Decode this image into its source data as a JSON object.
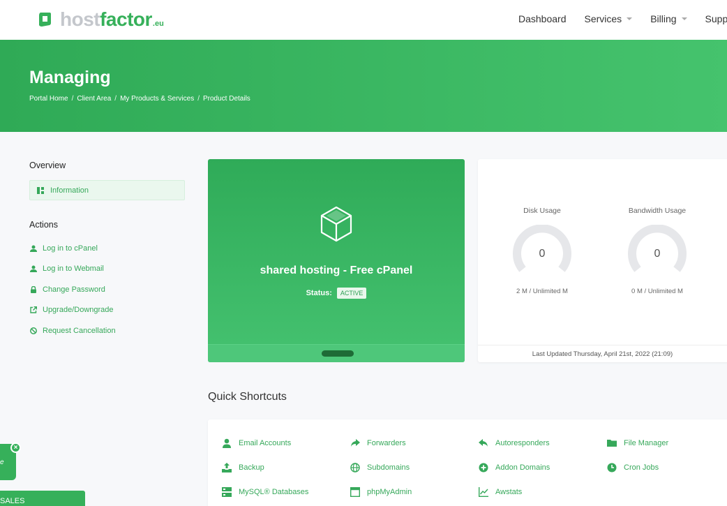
{
  "brand": {
    "host": "host",
    "factor": "factor",
    "tld": ".eu",
    "accent": "#36b05a"
  },
  "nav": [
    {
      "label": "Dashboard",
      "dropdown": false
    },
    {
      "label": "Services",
      "dropdown": true
    },
    {
      "label": "Billing",
      "dropdown": true
    },
    {
      "label": "Support",
      "dropdown": false
    }
  ],
  "banner": {
    "title": "Managing",
    "breadcrumb": [
      "Portal Home",
      "Client Area",
      "My Products & Services",
      "Product Details"
    ]
  },
  "sidebar": {
    "overview_title": "Overview",
    "overview_item": "Information",
    "actions_title": "Actions",
    "actions": [
      {
        "label": "Log in to cPanel",
        "icon": "user-icon"
      },
      {
        "label": "Log in to Webmail",
        "icon": "user-icon"
      },
      {
        "label": "Change Password",
        "icon": "lock-icon"
      },
      {
        "label": "Upgrade/Downgrade",
        "icon": "external-link-icon"
      },
      {
        "label": "Request Cancellation",
        "icon": "ban-icon"
      }
    ]
  },
  "product": {
    "name": "shared hosting - Free cPanel",
    "status_label": "Status:",
    "status_value": "ACTIVE"
  },
  "usage": {
    "disk": {
      "title": "Disk Usage",
      "value": "0",
      "detail": "2 M / Unlimited M",
      "fraction": 0
    },
    "bandwidth": {
      "title": "Bandwidth Usage",
      "value": "0",
      "detail": "0 M / Unlimited M",
      "fraction": 0
    },
    "last_updated": "Last Updated Thursday, April 21st, 2022 (21:09)"
  },
  "shortcuts": {
    "title": "Quick Shortcuts",
    "items": [
      {
        "label": "Email Accounts",
        "icon": "user-icon"
      },
      {
        "label": "Forwarders",
        "icon": "share-icon"
      },
      {
        "label": "Autoresponders",
        "icon": "reply-icon"
      },
      {
        "label": "File Manager",
        "icon": "folder-icon"
      },
      {
        "label": "Backup",
        "icon": "upload-icon"
      },
      {
        "label": "Subdomains",
        "icon": "globe-icon"
      },
      {
        "label": "Addon Domains",
        "icon": "plus-circle-icon"
      },
      {
        "label": "Cron Jobs",
        "icon": "clock-icon"
      },
      {
        "label": "MySQL® Databases",
        "icon": "database-icon"
      },
      {
        "label": "phpMyAdmin",
        "icon": "window-icon"
      },
      {
        "label": "Awstats",
        "icon": "line-chart-icon"
      }
    ]
  },
  "widgets": {
    "chat_text": "e",
    "close": "×",
    "sales": "SALES"
  }
}
